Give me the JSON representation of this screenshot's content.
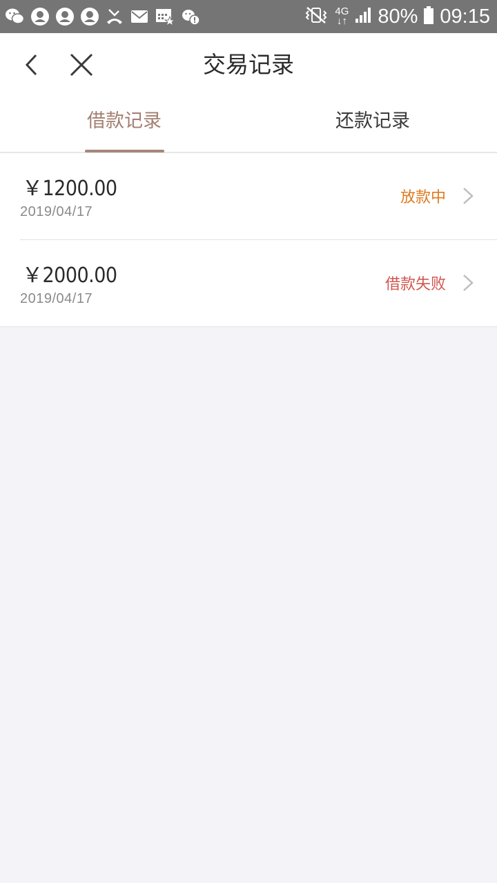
{
  "status_bar": {
    "battery": "80%",
    "time": "09:15",
    "network_top": "4G",
    "network_bottom": "↓↑"
  },
  "header": {
    "title": "交易记录"
  },
  "tabs": [
    {
      "label": "借款记录",
      "active": true
    },
    {
      "label": "还款记录",
      "active": false
    }
  ],
  "records": [
    {
      "amount": "￥1200.00",
      "date": "2019/04/17",
      "status": "放款中",
      "status_color": "#e07a1e"
    },
    {
      "amount": "￥2000.00",
      "date": "2019/04/17",
      "status": "借款失败",
      "status_color": "#d0574f"
    }
  ],
  "colors": {
    "accent": "#a37f72",
    "status_bar": "#757575",
    "page_background": "#f3f3f8"
  }
}
